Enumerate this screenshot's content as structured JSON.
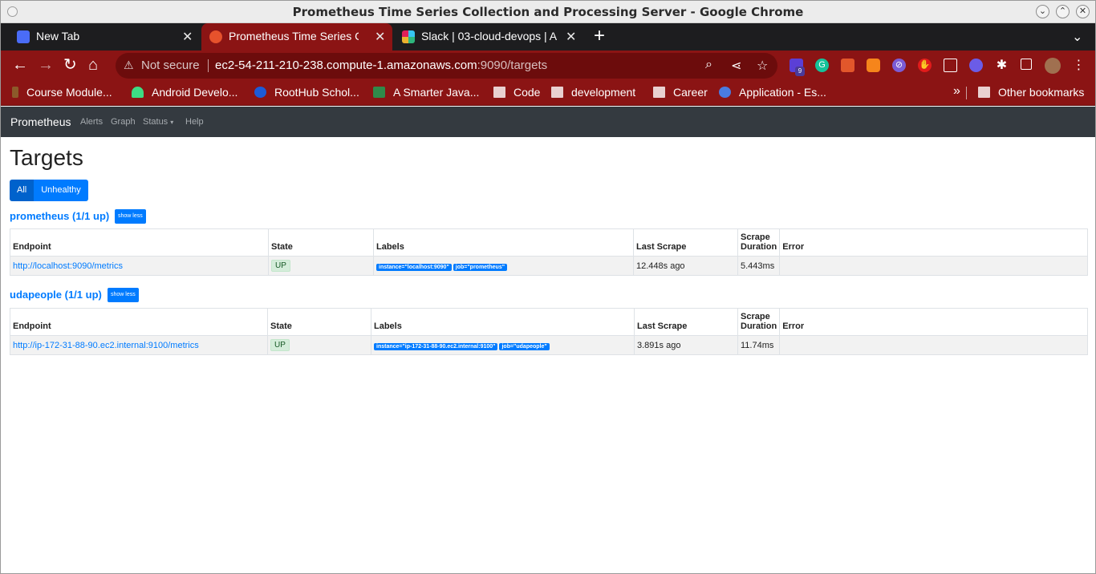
{
  "window": {
    "title": "Prometheus Time Series Collection and Processing Server - Google Chrome",
    "minimize": "⌄",
    "maximize": "⌃",
    "close": "✕"
  },
  "tabs": [
    {
      "label": "New Tab",
      "close": "✕"
    },
    {
      "label": "Prometheus Time Series Co",
      "close": "✕"
    },
    {
      "label": "Slack | 03-cloud-devops | A",
      "close": "✕"
    }
  ],
  "new_tab": "+",
  "tab_menu": "⌄",
  "toolbar": {
    "back": "←",
    "forward": "→",
    "reload": "↻",
    "home": "⌂",
    "security_label": "Not secure",
    "url_host": "ec2-54-211-210-238.compute-1.amazonaws.com",
    "url_path": ":9090/targets",
    "extension_badge": "9"
  },
  "bookmarks": [
    {
      "label": "Course Module..."
    },
    {
      "label": "Android Develo..."
    },
    {
      "label": "RootHub Schol..."
    },
    {
      "label": "A Smarter Java..."
    },
    {
      "label": "Code"
    },
    {
      "label": "development"
    },
    {
      "label": "Career"
    },
    {
      "label": "Application - Es..."
    }
  ],
  "bookmarks_overflow": "»",
  "other_bookmarks": "Other bookmarks",
  "prom_nav": {
    "brand": "Prometheus",
    "links": [
      "Alerts",
      "Graph",
      "Status",
      "Help"
    ]
  },
  "page": {
    "title": "Targets",
    "filter_all": "All",
    "filter_unhealthy": "Unhealthy",
    "show_less": "show less",
    "columns": {
      "endpoint": "Endpoint",
      "state": "State",
      "labels": "Labels",
      "last_scrape": "Last Scrape",
      "duration_line1": "Scrape",
      "duration_line2": "Duration",
      "error": "Error"
    }
  },
  "pools": [
    {
      "name": "prometheus (1/1 up)",
      "endpoint": "http://localhost:9090/metrics",
      "state": "UP",
      "labels": [
        "instance=\"localhost:9090\"",
        "job=\"prometheus\""
      ],
      "last_scrape": "12.448s ago",
      "duration": "5.443ms",
      "error": ""
    },
    {
      "name": "udapeople (1/1 up)",
      "endpoint": "http://ip-172-31-88-90.ec2.internal:9100/metrics",
      "state": "UP",
      "labels": [
        "instance=\"ip-172-31-88-90.ec2.internal:9100\"",
        "job=\"udapeople\""
      ],
      "last_scrape": "3.891s ago",
      "duration": "11.74ms",
      "error": ""
    }
  ]
}
